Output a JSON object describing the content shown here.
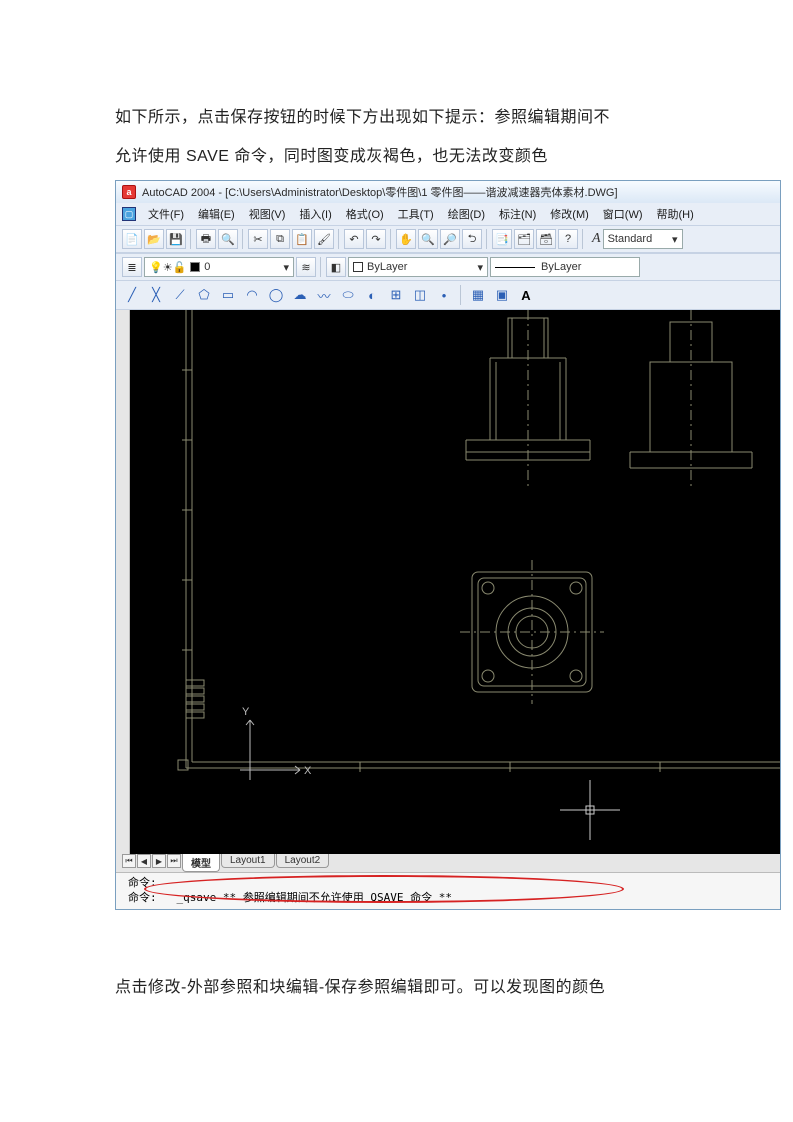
{
  "paragraphs": {
    "p1": "如下所示，点击保存按钮的时候下方出现如下提示：参照编辑期间不",
    "p2": "允许使用 SAVE 命令，同时图变成灰褐色，也无法改变颜色",
    "p3": "点击修改-外部参照和块编辑-保存参照编辑即可。可以发现图的颜色"
  },
  "window": {
    "app_letter": "a",
    "title": "AutoCAD 2004 - [C:\\Users\\Administrator\\Desktop\\零件图\\1 零件图——谐波减速器壳体素材.DWG]"
  },
  "menu": [
    "文件(F)",
    "编辑(E)",
    "视图(V)",
    "插入(I)",
    "格式(O)",
    "工具(T)",
    "绘图(D)",
    "标注(N)",
    "修改(M)",
    "窗口(W)",
    "帮助(H)"
  ],
  "layer_combo_text": "ByLayer",
  "style_text": "Standard",
  "linetype_text": "ByLayer",
  "layer_icons_label": "0",
  "tabs": {
    "model": "模型",
    "l1": "Layout1",
    "l2": "Layout2"
  },
  "cmd": {
    "label1": "命令:",
    "label2": "命令:",
    "text": "_qsave ** 参照编辑期间不允许使用 QSAVE 命令 **"
  },
  "draw_A": "A"
}
